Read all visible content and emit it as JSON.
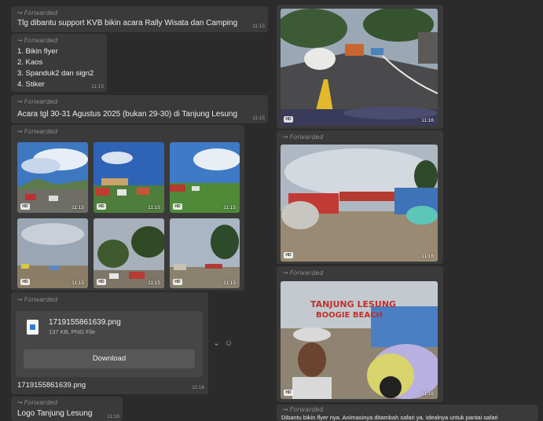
{
  "forwarded_label": "Forwarded",
  "msg1": {
    "text": "Tlg dibantu support KVB bikin acara Rally Wisata dan Camping",
    "time": "11:15"
  },
  "msg2": {
    "items": [
      "1. Bikin flyer",
      "2. Kaos",
      "3. Spanduk2 dan sign2",
      "4. Stiker"
    ],
    "time": "11:15"
  },
  "msg3": {
    "text": "Acara tgl 30-31 Agustus 2025 (bukan 29-30) di Tanjung Lesung",
    "time": "11:15"
  },
  "album": {
    "hd_label": "HD",
    "tiles": [
      {
        "time": "11:15"
      },
      {
        "time": "11:15"
      },
      {
        "time": "11:15"
      },
      {
        "time": "11:15"
      },
      {
        "time": "11:15"
      },
      {
        "time": "11:15"
      }
    ]
  },
  "file_msg": {
    "file_name": "1719155861639.png",
    "file_meta": "137 KB, PNG File",
    "download_label": "Download",
    "caption": "1719155861639.png",
    "time": "11:16"
  },
  "msg_logo": {
    "text": "Logo Tanjung Lesung",
    "time": "11:16"
  },
  "right_photos": [
    {
      "time": "11:16",
      "hd": "HD"
    },
    {
      "time": "11:16",
      "hd": "HD"
    },
    {
      "time": "11:16",
      "hd": "HD",
      "sign_line1": "TANJUNG LESUNG",
      "sign_line2": "BOOGIE BEACH"
    }
  ],
  "right_caption": "Dibantu bikin flyer nya. Animasinya ditambah safari ya. Idealnya untuk pantai safari"
}
